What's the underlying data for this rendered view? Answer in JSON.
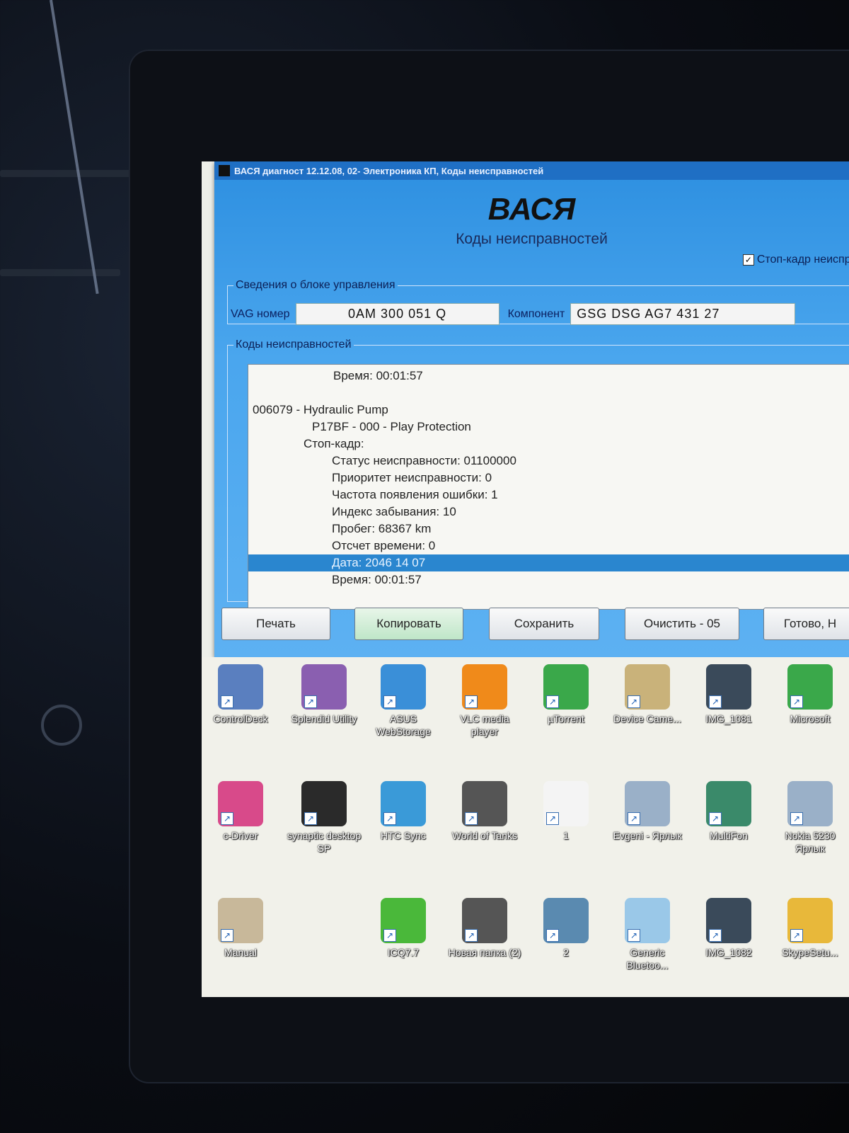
{
  "window": {
    "title": "ВАСЯ диагност 12.12.08, 02- Электроника КП, Коды неисправностей",
    "app_title": "ВАСЯ",
    "subtitle": "Коды неисправностей",
    "freeze_frame_checkbox": {
      "label": "Стоп-кадр неисправ",
      "checked": true
    }
  },
  "control_unit": {
    "legend": "Сведения о блоке управления",
    "vag_label": "VAG номер",
    "vag_value": "0AM 300 051 Q",
    "component_label": "Компонент",
    "component_value": "GSG DSG AG7    431 27"
  },
  "fault_codes": {
    "legend": "Коды неисправностей",
    "lines": [
      "Время: 00:01:57",
      "",
      "006079 - Hydraulic Pump",
      "P17BF - 000 - Play Protection",
      "Стоп-кадр:",
      "Статус неисправности: 01100000",
      "Приоритет неисправности: 0",
      "Частота появления ошибки: 1",
      "Индекс забывания: 10",
      "Пробег: 68367 km",
      "Отсчет времени: 0",
      "Дата: 2046 14 07",
      "Время: 00:01:57"
    ],
    "selected_index": 11
  },
  "buttons": {
    "print": "Печать",
    "copy": "Копировать",
    "save": "Сохранить",
    "clear": "Очистить - 05",
    "done": "Готово, Н"
  },
  "desktop_icons": [
    {
      "label": "ControlDeck",
      "icon": "controldeck-icon",
      "color": "#5a7fbf"
    },
    {
      "label": "Splendid Utility",
      "icon": "splendid-utility-icon",
      "color": "#8a5fb0"
    },
    {
      "label": "ASUS WebStorage",
      "icon": "asus-webstorage-icon",
      "color": "#3a8fd8"
    },
    {
      "label": "VLC media player",
      "icon": "vlc-icon",
      "color": "#f08a1a"
    },
    {
      "label": "µTorrent",
      "icon": "utorrent-icon",
      "color": "#3aa84a"
    },
    {
      "label": "Device Came...",
      "icon": "device-camera-icon",
      "color": "#c9b27a"
    },
    {
      "label": "IMG_1081",
      "icon": "photo-icon",
      "color": "#3a4a5a"
    },
    {
      "label": "Microsoft",
      "icon": "utorrent-icon",
      "color": "#3aa84a"
    },
    {
      "label": "c-Driver",
      "icon": "disc-icon",
      "color": "#d84a8a"
    },
    {
      "label": "synaptic desktop SP",
      "icon": "synaptic-icon",
      "color": "#2a2a2a"
    },
    {
      "label": "HTC Sync",
      "icon": "htc-sync-icon",
      "color": "#3a9ad8"
    },
    {
      "label": "World of Tanks",
      "icon": "world-of-tanks-icon",
      "color": "#555"
    },
    {
      "label": "1",
      "icon": "blank-file-icon",
      "color": "#f4f4f4"
    },
    {
      "label": "Evgeni - Ярлык",
      "icon": "phone-icon",
      "color": "#9ab0c8"
    },
    {
      "label": "MultiFon",
      "icon": "multifon-icon",
      "color": "#3a8a6a"
    },
    {
      "label": "Nokia 5230 Ярлык",
      "icon": "phone-icon",
      "color": "#9ab0c8"
    },
    {
      "label": "Manual",
      "icon": "manual-icon",
      "color": "#c8b89a"
    },
    {
      "label": "ICQ7.7",
      "icon": "icq-icon",
      "color": "#4ab83a"
    },
    {
      "label": "Новая папка (2)",
      "icon": "folder-icon",
      "color": "#555"
    },
    {
      "label": "2",
      "icon": "photo-icon",
      "color": "#5a8ab0"
    },
    {
      "label": "Generic Bluetoo...",
      "icon": "bluetooth-icon",
      "color": "#9ac8e8"
    },
    {
      "label": "IMG_1082",
      "icon": "photo-icon",
      "color": "#3a4a5a"
    },
    {
      "label": "SkypeSetu...",
      "icon": "skype-setup-icon",
      "color": "#e8b83a"
    }
  ]
}
